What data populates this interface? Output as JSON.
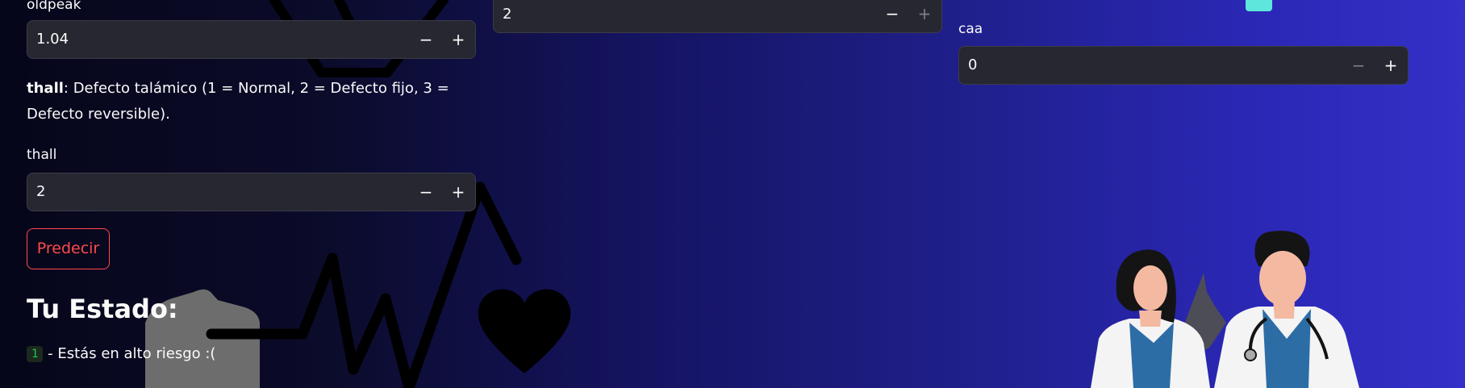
{
  "inputs": {
    "oldpeak": {
      "label": "oldpeak",
      "value": "1.04"
    },
    "slp": {
      "value": "2"
    },
    "caa": {
      "label": "caa",
      "value": "0"
    },
    "thall": {
      "label": "thall",
      "value": "2"
    }
  },
  "thall_description": {
    "term": "thall",
    "text": ": Defecto talámico (1 = Normal, 2 = Defecto fijo, 3 = Defecto reversible)."
  },
  "stepper": {
    "minus": "−",
    "plus": "+"
  },
  "predict_button": "Predecir",
  "status": {
    "heading": "Tu Estado:",
    "code": "1",
    "message": " - Estás en alto riesgo :("
  },
  "colors": {
    "accent": "#ff4b4b",
    "success": "#21c354",
    "input_bg": "#262730"
  },
  "icons": [
    "heart-icon",
    "ecg-line",
    "doctors-illustration"
  ]
}
